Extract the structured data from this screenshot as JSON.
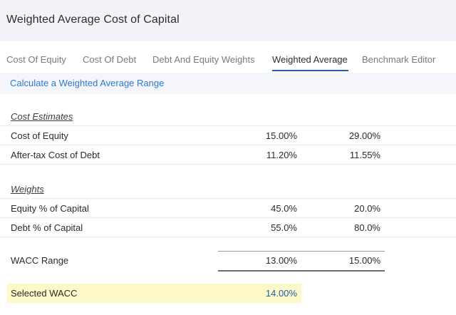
{
  "header": {
    "title": "Weighted Average Cost of Capital"
  },
  "tabs": [
    {
      "label": "Cost Of Equity"
    },
    {
      "label": "Cost Of Debt"
    },
    {
      "label": "Debt And Equity Weights"
    },
    {
      "label": "Weighted Average",
      "active": true
    },
    {
      "label": "Benchmark Editor"
    }
  ],
  "banner": {
    "link": "Calculate a Weighted Average Range"
  },
  "cost_estimates": {
    "heading": "Cost Estimates",
    "rows": [
      {
        "label": "Cost of Equity",
        "low": "15.00%",
        "high": "29.00%"
      },
      {
        "label": "After-tax Cost of Debt",
        "low": "11.20%",
        "high": "11.55%"
      }
    ]
  },
  "weights": {
    "heading": "Weights",
    "rows": [
      {
        "label": "Equity % of Capital",
        "low": "45.0%",
        "high": "20.0%"
      },
      {
        "label": "Debt % of Capital",
        "low": "55.0%",
        "high": "80.0%"
      }
    ]
  },
  "wacc_range": {
    "label": "WACC Range",
    "low": "13.00%",
    "high": "15.00%"
  },
  "selected_wacc": {
    "label": "Selected WACC",
    "value": "14.00%"
  },
  "colors": {
    "accent": "#1f5fa8",
    "link": "#2b7bcf",
    "highlight": "#fdf8c8",
    "header_bg": "#f2f3f8"
  }
}
